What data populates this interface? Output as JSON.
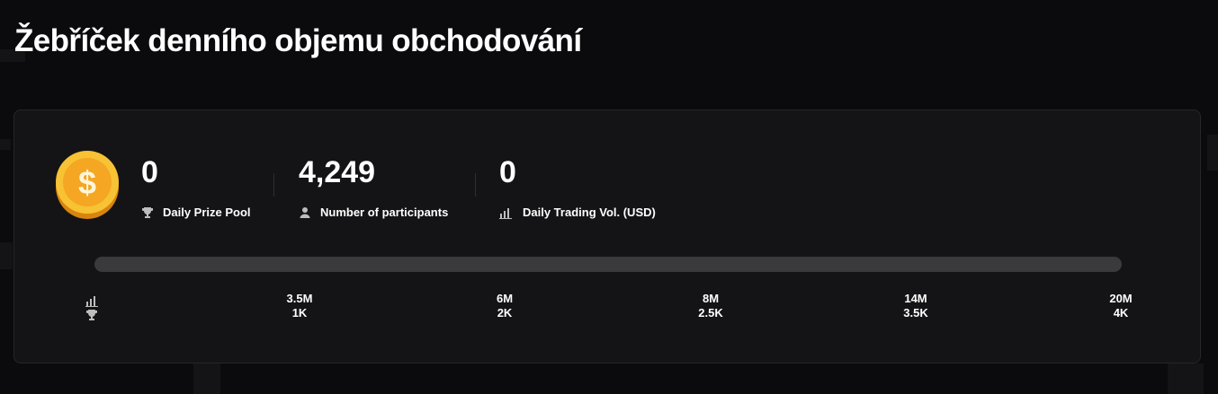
{
  "page": {
    "title": "Žebříček denního objemu obchodování"
  },
  "stats": [
    {
      "value": "0",
      "label": "Daily Prize Pool",
      "icon": "trophy-icon"
    },
    {
      "value": "4,249",
      "label": "Number of participants",
      "icon": "user-icon"
    },
    {
      "value": "0",
      "label": "Daily Trading Vol. (USD)",
      "icon": "bar-chart-icon"
    }
  ],
  "progress": {
    "fraction": 0
  },
  "milestones": [
    {
      "volume": "3.5M",
      "prize": "1K"
    },
    {
      "volume": "6M",
      "prize": "2K"
    },
    {
      "volume": "8M",
      "prize": "2.5K"
    },
    {
      "volume": "14M",
      "prize": "3.5K"
    },
    {
      "volume": "20M",
      "prize": "4K"
    }
  ],
  "colors": {
    "background": "#0b0b0d",
    "card": "#141416",
    "track": "#3a3a3d",
    "coin": "#f5a623"
  }
}
